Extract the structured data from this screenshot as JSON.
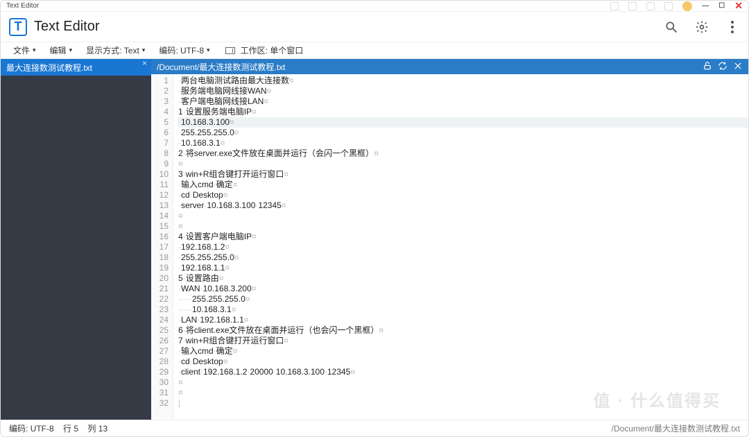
{
  "titlebar": {
    "title": "Text Editor"
  },
  "app": {
    "logo_letter": "T",
    "title": "Text Editor"
  },
  "menu": {
    "file": "文件",
    "edit": "编辑",
    "display": "显示方式:",
    "display_val": "Text",
    "encoding": "编码:",
    "encoding_val": "UTF-8",
    "workspace_label": "工作区:",
    "workspace_val": "单个窗口"
  },
  "sidebar": {
    "tab": "最大连接数测试教程.txt"
  },
  "path": "/Document/最大连接数测试教程.txt",
  "lines": [
    {
      "n": 1,
      "t": "·两台电脑测试路由最大连接数¤"
    },
    {
      "n": 2,
      "t": "·服务端电脑网线接WAN¤"
    },
    {
      "n": 3,
      "t": "·客户端电脑网线接LAN¤"
    },
    {
      "n": 4,
      "t": "1·设置服务端电脑IP¤"
    },
    {
      "n": 5,
      "t": "·10.168.3.100¤",
      "hl": true
    },
    {
      "n": 6,
      "t": "·255.255.255.0¤"
    },
    {
      "n": 7,
      "t": "·10.168.3.1¤"
    },
    {
      "n": 8,
      "t": "2·将server.exe文件放在桌面并运行（会闪一个黑框）¤"
    },
    {
      "n": 9,
      "t": "¤"
    },
    {
      "n": 10,
      "t": "3·win+R组合键打开运行窗口¤"
    },
    {
      "n": 11,
      "t": "·输入cmd·确定¤"
    },
    {
      "n": 12,
      "t": "·cd·Desktop¤"
    },
    {
      "n": 13,
      "t": "·server·10.168.3.100·12345¤"
    },
    {
      "n": 14,
      "t": "¤"
    },
    {
      "n": 15,
      "t": "¤"
    },
    {
      "n": 16,
      "t": "4·设置客户端电脑IP¤"
    },
    {
      "n": 17,
      "t": "·192.168.1.2¤"
    },
    {
      "n": 18,
      "t": "·255.255.255.0¤"
    },
    {
      "n": 19,
      "t": "·192.168.1.1¤"
    },
    {
      "n": 20,
      "t": "5·设置路由¤"
    },
    {
      "n": 21,
      "t": "·WAN·10.168.3.200¤"
    },
    {
      "n": 22,
      "t": "·····255.255.255.0¤"
    },
    {
      "n": 23,
      "t": "·····10.168.3.1¤"
    },
    {
      "n": 24,
      "t": "·LAN·192.168.1.1¤"
    },
    {
      "n": 25,
      "t": "6·将client.exe文件放在桌面并运行（也会闪一个黑框）¤"
    },
    {
      "n": 26,
      "t": "7·win+R组合键打开运行窗口¤"
    },
    {
      "n": 27,
      "t": "·输入cmd·确定¤"
    },
    {
      "n": 28,
      "t": "·cd·Desktop¤"
    },
    {
      "n": 29,
      "t": "·client·192.168.1.2·20000·10.168.3.100·12345¤"
    },
    {
      "n": 30,
      "t": "¤"
    },
    {
      "n": 31,
      "t": "¤"
    },
    {
      "n": 32,
      "t": "¦"
    }
  ],
  "status": {
    "encoding_label": "编码:",
    "encoding_val": "UTF-8",
    "row_label": "行",
    "row_val": "5",
    "col_label": "列",
    "col_val": "13",
    "right_path": "/Document/最大连接数测试教程.txt"
  },
  "watermark": "值 · 什么值得买"
}
